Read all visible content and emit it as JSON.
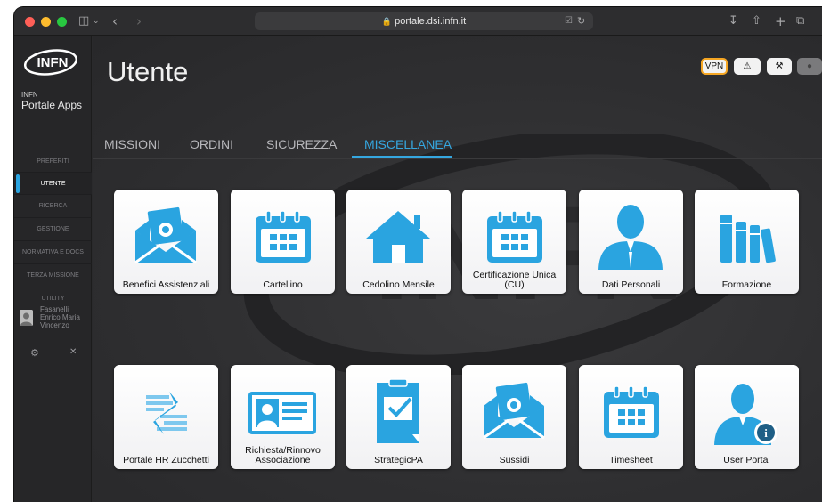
{
  "browser": {
    "url": "portale.dsi.infn.it",
    "icons": [
      "close-dot",
      "minimize-dot",
      "zoom-dot",
      "sidebar-toggle-icon",
      "back-icon",
      "forward-icon",
      "lock-icon",
      "translate-icon",
      "reload-icon",
      "download-icon",
      "share-icon",
      "new-tab-icon",
      "tabs-overview-icon"
    ]
  },
  "sidebar": {
    "logo_text": "INFN",
    "brand_small": "INFN",
    "brand_title": "Portale Apps",
    "items": [
      {
        "label": "PREFERITI",
        "active": false
      },
      {
        "label": "UTENTE",
        "active": true
      },
      {
        "label": "RICERCA",
        "active": false
      },
      {
        "label": "GESTIONE",
        "active": false
      },
      {
        "label": "NORMATIVA E DOCS",
        "active": false
      },
      {
        "label": "TERZA MISSIONE",
        "active": false
      },
      {
        "label": "UTILITY",
        "active": false
      }
    ],
    "user_name": "Fasanelli Enrico Maria Vincenzo",
    "settings_icon": "gear-icon",
    "close_icon": "close-icon"
  },
  "header": {
    "title": "Utente",
    "vpn_label": "VPN",
    "buttons": [
      "warning-icon",
      "tools-icon",
      "toggle-icon"
    ]
  },
  "tabs": [
    {
      "label": "MISSIONI",
      "active": false
    },
    {
      "label": "ORDINI",
      "active": false
    },
    {
      "label": "SICUREZZA",
      "active": false
    },
    {
      "label": "MISCELLANEA",
      "active": true
    }
  ],
  "tiles": [
    {
      "label": "Benefici Assistenziali",
      "icon": "envelope-money-icon"
    },
    {
      "label": "Cartellino",
      "icon": "calendar-icon"
    },
    {
      "label": "Cedolino Mensile",
      "icon": "house-icon"
    },
    {
      "label": "Certificazione Unica (CU)",
      "icon": "calendar-icon"
    },
    {
      "label": "Dati Personali",
      "icon": "person-icon"
    },
    {
      "label": "Formazione",
      "icon": "books-icon"
    },
    {
      "label": "Portale HR Zucchetti",
      "icon": "zucchetti-logo-icon"
    },
    {
      "label": "Richiesta/Rinnovo Associazione",
      "icon": "id-card-icon"
    },
    {
      "label": "StrategicPA",
      "icon": "clipboard-check-icon"
    },
    {
      "label": "Sussidi",
      "icon": "envelope-money-icon"
    },
    {
      "label": "Timesheet",
      "icon": "calendar-icon"
    },
    {
      "label": "User Portal",
      "icon": "user-info-icon"
    }
  ],
  "colors": {
    "accent": "#35a7e0",
    "icon_blue": "#2aa4e0",
    "vpn_border": "#f5a623",
    "sidebar_bg": "#262628",
    "main_bg": "#2f2f31"
  }
}
